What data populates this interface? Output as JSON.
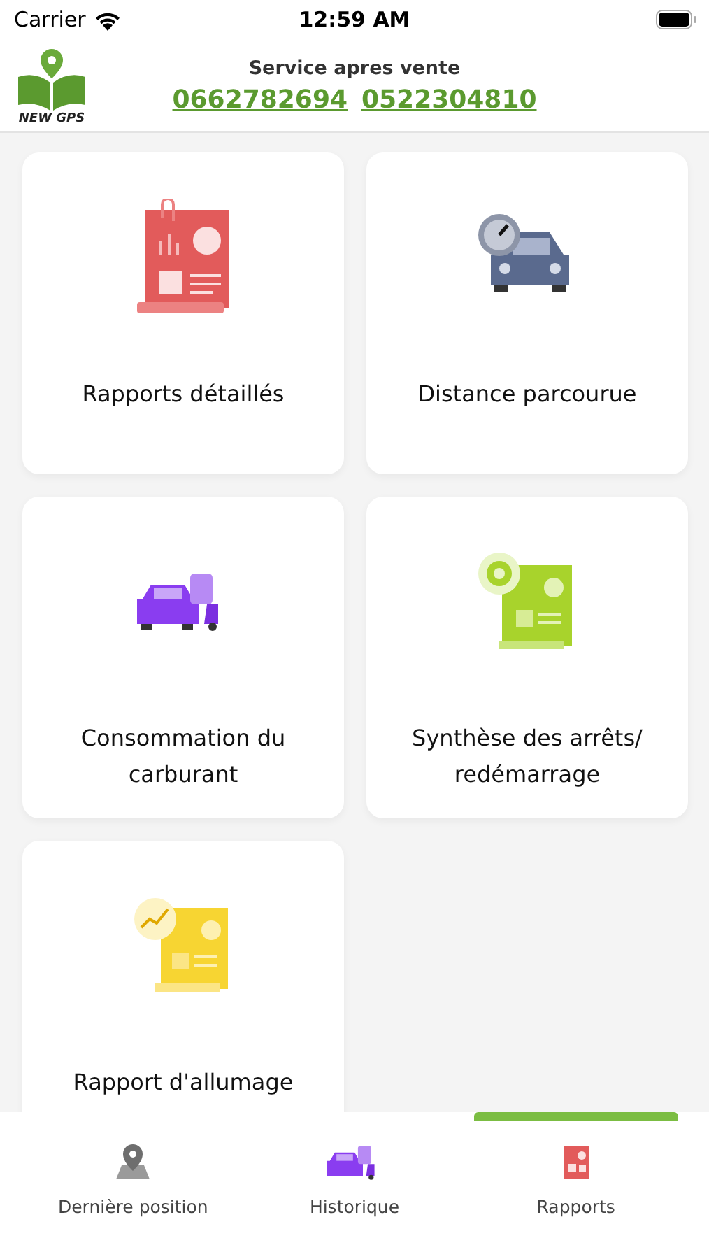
{
  "status_bar": {
    "carrier": "Carrier",
    "time": "12:59 AM"
  },
  "header": {
    "title": "Service apres vente",
    "phones": [
      "0662782694",
      "0522304810"
    ],
    "logo_text": "NEW GPS"
  },
  "cards": [
    {
      "label": "Rapports détaillés",
      "kind": "report"
    },
    {
      "label": "Distance parcourue",
      "kind": "car"
    },
    {
      "label": "Consommation du carburant",
      "kind": "fleet"
    },
    {
      "label": "Synthèse des arrêts/ redémarrage",
      "kind": "report-gear"
    },
    {
      "label": "Rapport d'allumage",
      "kind": "report-chart"
    }
  ],
  "tabs": [
    {
      "label": "Dernière position",
      "kind": "pin",
      "selected": false
    },
    {
      "label": "Historique",
      "kind": "fleet",
      "selected": false
    },
    {
      "label": "Rapports",
      "kind": "report",
      "selected": true
    }
  ]
}
